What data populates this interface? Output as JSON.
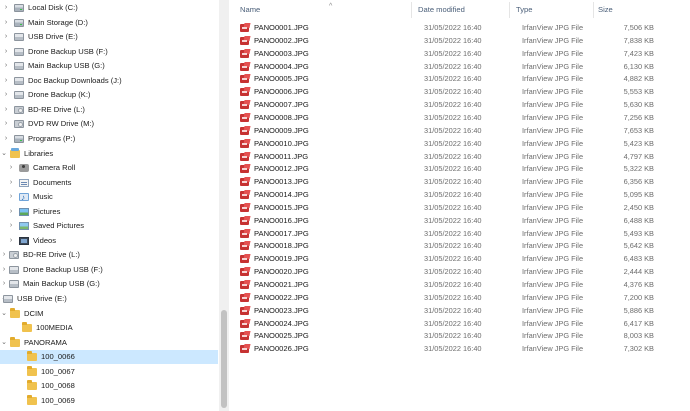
{
  "nav": {
    "items": [
      {
        "label": "Local Disk (C:)",
        "icon": "drive-icon",
        "expanded": false
      },
      {
        "label": "Main Storage (D:)",
        "icon": "drive-icon",
        "expanded": false
      },
      {
        "label": "USB Drive (E:)",
        "icon": "usb-drive-icon",
        "expanded": false
      },
      {
        "label": "Drone Backup USB (F:)",
        "icon": "usb-drive-icon",
        "expanded": false
      },
      {
        "label": "Main Backup USB (G:)",
        "icon": "usb-drive-icon",
        "expanded": false
      },
      {
        "label": "Doc Backup  Downloads (J:)",
        "icon": "usb-drive-icon",
        "expanded": false
      },
      {
        "label": "Drone Backup (K:)",
        "icon": "usb-drive-icon",
        "expanded": false
      },
      {
        "label": "BD-RE Drive (L:)",
        "icon": "optical-drive-icon",
        "expanded": false
      },
      {
        "label": "DVD RW Drive (M:)",
        "icon": "optical-drive-icon",
        "expanded": false
      },
      {
        "label": "Programs (P:)",
        "icon": "drive-icon",
        "expanded": false
      },
      {
        "label": "Libraries",
        "icon": "libraries-icon",
        "expanded": true
      },
      {
        "label": "Camera Roll",
        "icon": "camera-icon",
        "expanded": false
      },
      {
        "label": "Documents",
        "icon": "documents-icon",
        "expanded": false
      },
      {
        "label": "Music",
        "icon": "music-icon",
        "expanded": false
      },
      {
        "label": "Pictures",
        "icon": "pictures-icon",
        "expanded": false
      },
      {
        "label": "Saved Pictures",
        "icon": "saved-pictures-icon",
        "expanded": false
      },
      {
        "label": "Videos",
        "icon": "videos-icon",
        "expanded": false
      },
      {
        "label": "BD-RE Drive (L:)",
        "icon": "optical-drive-icon",
        "expanded": false
      },
      {
        "label": "Drone Backup USB (F:)",
        "icon": "usb-drive-icon",
        "expanded": false
      },
      {
        "label": "Main Backup USB (G:)",
        "icon": "usb-drive-icon",
        "expanded": false
      },
      {
        "label": "USB Drive (E:)",
        "icon": "usb-drive-icon",
        "expanded": true
      },
      {
        "label": "DCIM",
        "icon": "folder-icon",
        "expanded": true
      },
      {
        "label": "100MEDIA",
        "icon": "folder-icon",
        "expanded": false
      },
      {
        "label": "PANORAMA",
        "icon": "folder-icon",
        "expanded": true
      },
      {
        "label": "100_0066",
        "icon": "folder-icon",
        "expanded": false,
        "selected": true
      },
      {
        "label": "100_0067",
        "icon": "folder-icon",
        "expanded": false
      },
      {
        "label": "100_0068",
        "icon": "folder-icon",
        "expanded": false
      },
      {
        "label": "100_0069",
        "icon": "folder-icon",
        "expanded": false
      }
    ]
  },
  "columns": {
    "name": "Name",
    "date_modified": "Date modified",
    "type": "Type",
    "size": "Size"
  },
  "files": [
    {
      "name": "PANO0001.JPG",
      "date": "31/05/2022 16:40",
      "type": "IrfanView JPG File",
      "size": "7,506 KB"
    },
    {
      "name": "PANO0002.JPG",
      "date": "31/05/2022 16:40",
      "type": "IrfanView JPG File",
      "size": "7,838 KB"
    },
    {
      "name": "PANO0003.JPG",
      "date": "31/05/2022 16:40",
      "type": "IrfanView JPG File",
      "size": "7,423 KB"
    },
    {
      "name": "PANO0004.JPG",
      "date": "31/05/2022 16:40",
      "type": "IrfanView JPG File",
      "size": "6,130 KB"
    },
    {
      "name": "PANO0005.JPG",
      "date": "31/05/2022 16:40",
      "type": "IrfanView JPG File",
      "size": "4,882 KB"
    },
    {
      "name": "PANO0006.JPG",
      "date": "31/05/2022 16:40",
      "type": "IrfanView JPG File",
      "size": "5,553 KB"
    },
    {
      "name": "PANO0007.JPG",
      "date": "31/05/2022 16:40",
      "type": "IrfanView JPG File",
      "size": "5,630 KB"
    },
    {
      "name": "PANO0008.JPG",
      "date": "31/05/2022 16:40",
      "type": "IrfanView JPG File",
      "size": "7,256 KB"
    },
    {
      "name": "PANO0009.JPG",
      "date": "31/05/2022 16:40",
      "type": "IrfanView JPG File",
      "size": "7,653 KB"
    },
    {
      "name": "PANO0010.JPG",
      "date": "31/05/2022 16:40",
      "type": "IrfanView JPG File",
      "size": "5,423 KB"
    },
    {
      "name": "PANO0011.JPG",
      "date": "31/05/2022 16:40",
      "type": "IrfanView JPG File",
      "size": "4,797 KB"
    },
    {
      "name": "PANO0012.JPG",
      "date": "31/05/2022 16:40",
      "type": "IrfanView JPG File",
      "size": "5,322 KB"
    },
    {
      "name": "PANO0013.JPG",
      "date": "31/05/2022 16:40",
      "type": "IrfanView JPG File",
      "size": "6,356 KB"
    },
    {
      "name": "PANO0014.JPG",
      "date": "31/05/2022 16:40",
      "type": "IrfanView JPG File",
      "size": "5,095 KB"
    },
    {
      "name": "PANO0015.JPG",
      "date": "31/05/2022 16:40",
      "type": "IrfanView JPG File",
      "size": "2,450 KB"
    },
    {
      "name": "PANO0016.JPG",
      "date": "31/05/2022 16:40",
      "type": "IrfanView JPG File",
      "size": "6,488 KB"
    },
    {
      "name": "PANO0017.JPG",
      "date": "31/05/2022 16:40",
      "type": "IrfanView JPG File",
      "size": "5,493 KB"
    },
    {
      "name": "PANO0018.JPG",
      "date": "31/05/2022 16:40",
      "type": "IrfanView JPG File",
      "size": "5,642 KB"
    },
    {
      "name": "PANO0019.JPG",
      "date": "31/05/2022 16:40",
      "type": "IrfanView JPG File",
      "size": "6,483 KB"
    },
    {
      "name": "PANO0020.JPG",
      "date": "31/05/2022 16:40",
      "type": "IrfanView JPG File",
      "size": "2,444 KB"
    },
    {
      "name": "PANO0021.JPG",
      "date": "31/05/2022 16:40",
      "type": "IrfanView JPG File",
      "size": "4,376 KB"
    },
    {
      "name": "PANO0022.JPG",
      "date": "31/05/2022 16:40",
      "type": "IrfanView JPG File",
      "size": "7,200 KB"
    },
    {
      "name": "PANO0023.JPG",
      "date": "31/05/2022 16:40",
      "type": "IrfanView JPG File",
      "size": "5,886 KB"
    },
    {
      "name": "PANO0024.JPG",
      "date": "31/05/2022 16:40",
      "type": "IrfanView JPG File",
      "size": "6,417 KB"
    },
    {
      "name": "PANO0025.JPG",
      "date": "31/05/2022 16:40",
      "type": "IrfanView JPG File",
      "size": "8,003 KB"
    },
    {
      "name": "PANO0026.JPG",
      "date": "31/05/2022 16:40",
      "type": "IrfanView JPG File",
      "size": "7,302 KB"
    }
  ],
  "colors": {
    "selection": "#cce8ff",
    "header_text": "#4c607a",
    "jpg_icon": "#c63232"
  }
}
